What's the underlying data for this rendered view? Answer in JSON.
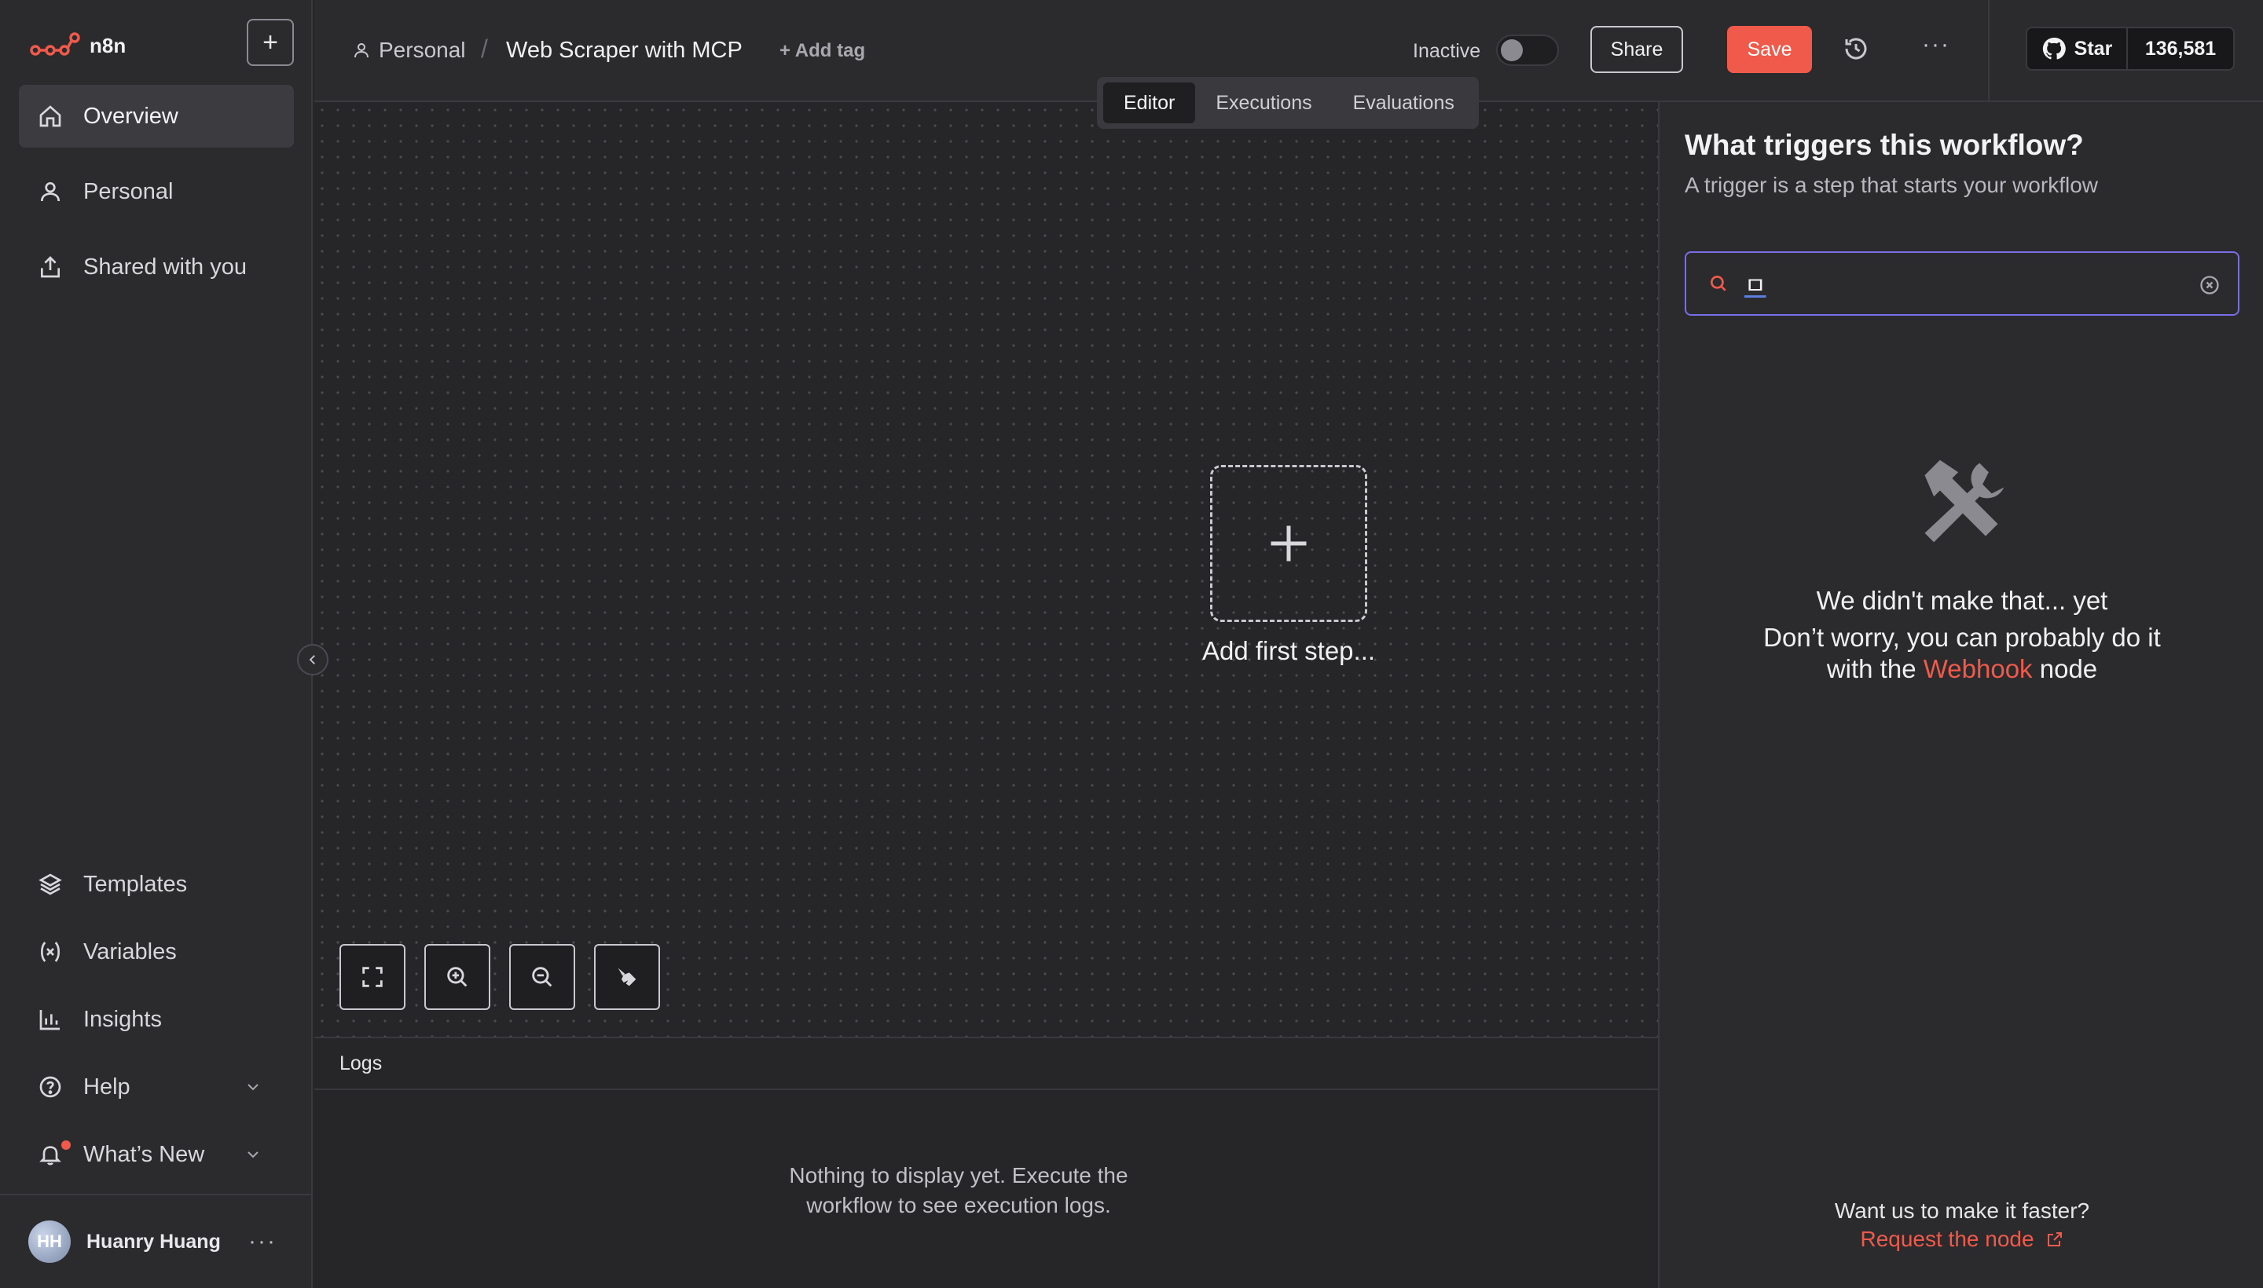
{
  "app": {
    "logo_text": "n8n",
    "accent_color": "#ef5a4b",
    "focus_color": "#7a6ee8"
  },
  "sidebar": {
    "new_button_label": "+",
    "top_items": [
      {
        "label": "Overview",
        "icon": "home-icon",
        "active": true
      },
      {
        "label": "Personal",
        "icon": "user-icon",
        "active": false
      },
      {
        "label": "Shared with you",
        "icon": "share-icon",
        "active": false
      }
    ],
    "bottom_items": [
      {
        "label": "Templates",
        "icon": "templates-icon"
      },
      {
        "label": "Variables",
        "icon": "variables-icon"
      },
      {
        "label": "Insights",
        "icon": "chart-icon"
      },
      {
        "label": "Help",
        "icon": "help-icon"
      },
      {
        "label": "What’s New",
        "icon": "bell-icon"
      }
    ],
    "user": {
      "initials": "HH",
      "name": "Huanry Huang",
      "more": "···"
    }
  },
  "header": {
    "breadcrumb_project": "Personal",
    "breadcrumb_sep": "/",
    "workflow_title": "Web Scraper with MCP",
    "add_tag": "+ Add tag",
    "status_label": "Inactive",
    "share_label": "Share",
    "save_label": "Save",
    "more": "···",
    "github_star": "Star",
    "github_count": "136,581"
  },
  "tabs": [
    {
      "label": "Editor",
      "active": true
    },
    {
      "label": "Executions",
      "active": false
    },
    {
      "label": "Evaluations",
      "active": false
    }
  ],
  "canvas": {
    "add_first_step": "Add first step..."
  },
  "logs": {
    "title": "Logs",
    "empty_line1": "Nothing to display yet. Execute the",
    "empty_line2": "workflow to see execution logs."
  },
  "panel": {
    "title": "What triggers this workflow?",
    "subtitle": "A trigger is a step that starts your workflow",
    "search_value": "ㅁ",
    "empty_title": "We didn't make that... yet",
    "empty_line1": "Don’t worry, you can probably do it",
    "empty_line2_pre": "with the",
    "empty_link": "Webhook",
    "empty_line2_post": "node",
    "faster": "Want us to make it faster?",
    "request_link": "Request the node"
  }
}
